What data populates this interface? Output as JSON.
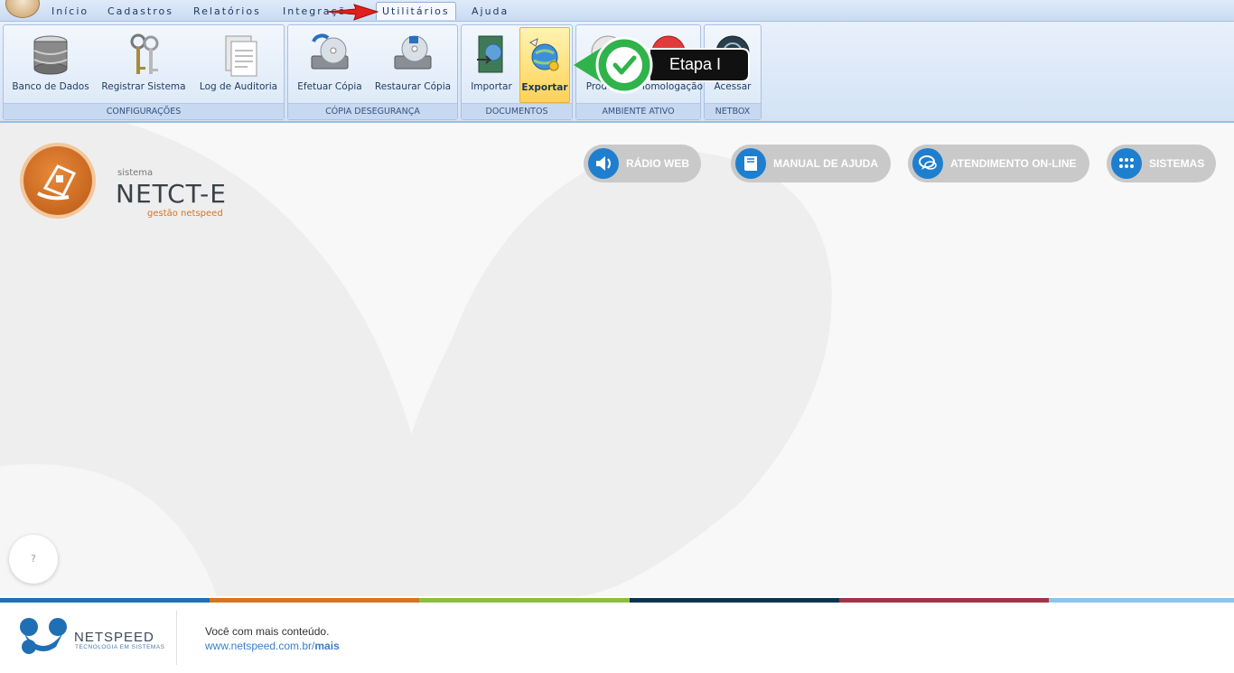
{
  "menu": {
    "items": [
      "Início",
      "Cadastros",
      "Relatórios",
      "Integrações",
      "Utilitários",
      "Ajuda"
    ],
    "active": "Utilitários"
  },
  "ribbon": {
    "groups": [
      {
        "label": "CONFIGURAÇÕES",
        "buttons": [
          {
            "label": "Banco de Dados",
            "icon": "database-icon"
          },
          {
            "label": "Registrar Sistema",
            "icon": "keys-icon"
          },
          {
            "label": "Log de Auditoria",
            "icon": "document-icon"
          }
        ]
      },
      {
        "label": "CÓPIA DESEGURANÇA",
        "buttons": [
          {
            "label": "Efetuar Cópia",
            "icon": "backup-disk-icon"
          },
          {
            "label": "Restaurar Cópia",
            "icon": "restore-disk-icon"
          }
        ]
      },
      {
        "label": "DOCUMENTOS",
        "buttons": [
          {
            "label": "Importar",
            "icon": "import-icon"
          },
          {
            "label": "Exportar",
            "icon": "export-globe-icon"
          }
        ]
      },
      {
        "label": "AMBIENTE ATIVO",
        "buttons": [
          {
            "label": "Produção",
            "icon": "production-icon"
          },
          {
            "label": "Homologação",
            "icon": "homologation-icon"
          }
        ]
      },
      {
        "label": "NETBOX",
        "buttons": [
          {
            "label": "Acessar",
            "icon": "netbox-icon"
          }
        ]
      }
    ]
  },
  "callout": {
    "text": "Etapa I",
    "icon": "check-icon"
  },
  "brand": {
    "sistema": "sistema",
    "title": "NETCT-E",
    "subtitle": "gestão netspeed"
  },
  "quick_links": [
    {
      "label": "RÁDIO WEB",
      "icon": "speaker-icon"
    },
    {
      "label": "MANUAL DE AJUDA",
      "icon": "book-icon"
    },
    {
      "label": "ATENDIMENTO ON-LINE",
      "icon": "chat-icon"
    },
    {
      "label": "SISTEMAS",
      "icon": "grid-icon"
    }
  ],
  "help": {
    "label": "?"
  },
  "footer": {
    "brand": "NETSPEED",
    "tagline": "TECNOLOGIA EM SISTEMAS",
    "line1": "Você com mais conteúdo.",
    "link_prefix": "www.netspeed.com.br/",
    "link_suffix": "mais"
  },
  "colors": {
    "stripe": [
      "#1f6fb5",
      "#d7741f",
      "#8cbf3f",
      "#0d3550",
      "#a23347",
      "#8fc3ea"
    ],
    "accent_orange": "#d7741f",
    "link_blue": "#3b7ec9"
  }
}
